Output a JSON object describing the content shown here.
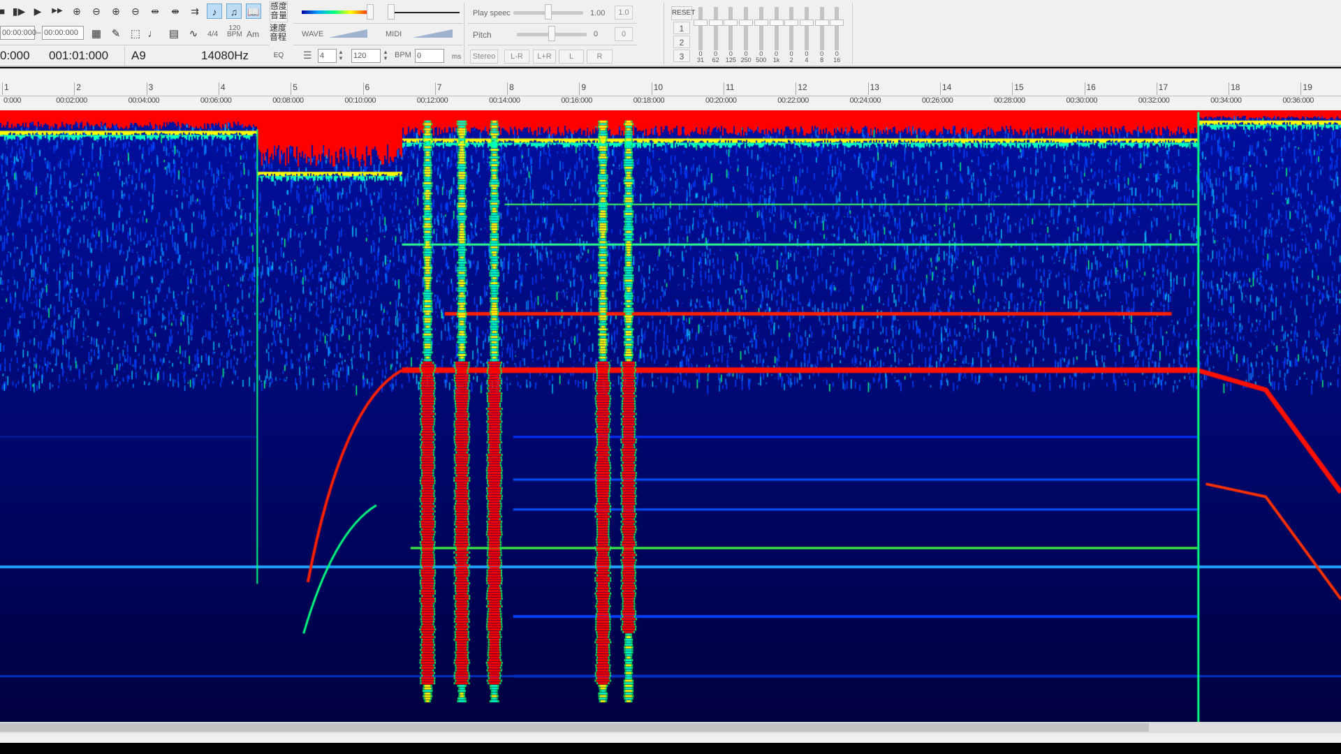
{
  "toolbar": {
    "transport_icons": [
      "stop-icon",
      "step-play-icon",
      "play-icon",
      "fast-forward-icon",
      "zoom-in-horizontal-icon",
      "zoom-out-horizontal-icon",
      "zoom-in-vertical-icon",
      "zoom-out-vertical-icon",
      "expand-icon",
      "compress-icon",
      "loop-icon",
      "wave-view-icon",
      "midi-view-icon",
      "book-icon"
    ],
    "tab_sensitivity": "感度\n音量",
    "tab_speed": "速度\n音程",
    "tab_eq": "EQ",
    "range_start": "00:00:000",
    "range_sep": "–",
    "range_end": "00:00:000",
    "tool_icons": [
      "layout-icon",
      "pencil-icon",
      "select-rect-icon",
      "note-icon",
      "grid-icon",
      "curve-icon"
    ],
    "time_sig": "4/4",
    "tempo_top": "120",
    "tempo_bottom": "BPM",
    "key": "Am",
    "position_time": "0:000",
    "position_measure": "001:01:000",
    "note": "A9",
    "frequency": "14080Hz",
    "wave_label": "WAVE",
    "midi_label": "MIDI",
    "beats_value": "4",
    "bpm_value": "120",
    "bpm_label": "BPM",
    "offset_value": "0",
    "ms_label": "ms",
    "play_speed_label": "Play speec",
    "play_speed_value": "1.00",
    "play_speed_reset": "1.0",
    "play_speed_level": 0.5,
    "pitch_label": "Pitch",
    "pitch_value": "0",
    "pitch_reset": "0",
    "pitch_level": 0.5,
    "channel_buttons": [
      "Stereo",
      "L-R",
      "L+R",
      "L",
      "R"
    ],
    "eq_reset": "RESET",
    "eq_presets": [
      "1",
      "2",
      "3"
    ],
    "eq_bands": [
      {
        "freq": "31",
        "gain": "0"
      },
      {
        "freq": "62",
        "gain": "0"
      },
      {
        "freq": "125",
        "gain": "0"
      },
      {
        "freq": "250",
        "gain": "0"
      },
      {
        "freq": "500",
        "gain": "0"
      },
      {
        "freq": "1k",
        "gain": "0"
      },
      {
        "freq": "2",
        "gain": "0"
      },
      {
        "freq": "4",
        "gain": "0"
      },
      {
        "freq": "8",
        "gain": "0"
      },
      {
        "freq": "16",
        "gain": "0"
      }
    ]
  },
  "ruler": {
    "measures": [
      "1",
      "2",
      "3",
      "4",
      "5",
      "6",
      "7",
      "8",
      "9",
      "10",
      "11",
      "12",
      "13",
      "14",
      "15",
      "16",
      "17",
      "18",
      "19"
    ],
    "times": [
      "0:000",
      "00:02:000",
      "00:04:000",
      "00:06:000",
      "00:08:000",
      "00:10:000",
      "00:12:000",
      "00:14:000",
      "00:16:000",
      "00:18:000",
      "00:20:000",
      "00:22:000",
      "00:24:000",
      "00:26:000",
      "00:28:000",
      "00:30:000",
      "00:32:000",
      "00:34:000",
      "00:36:000"
    ]
  },
  "colors": {
    "low": "#000060",
    "mid": "#00ff80",
    "high": "#ff0000"
  }
}
